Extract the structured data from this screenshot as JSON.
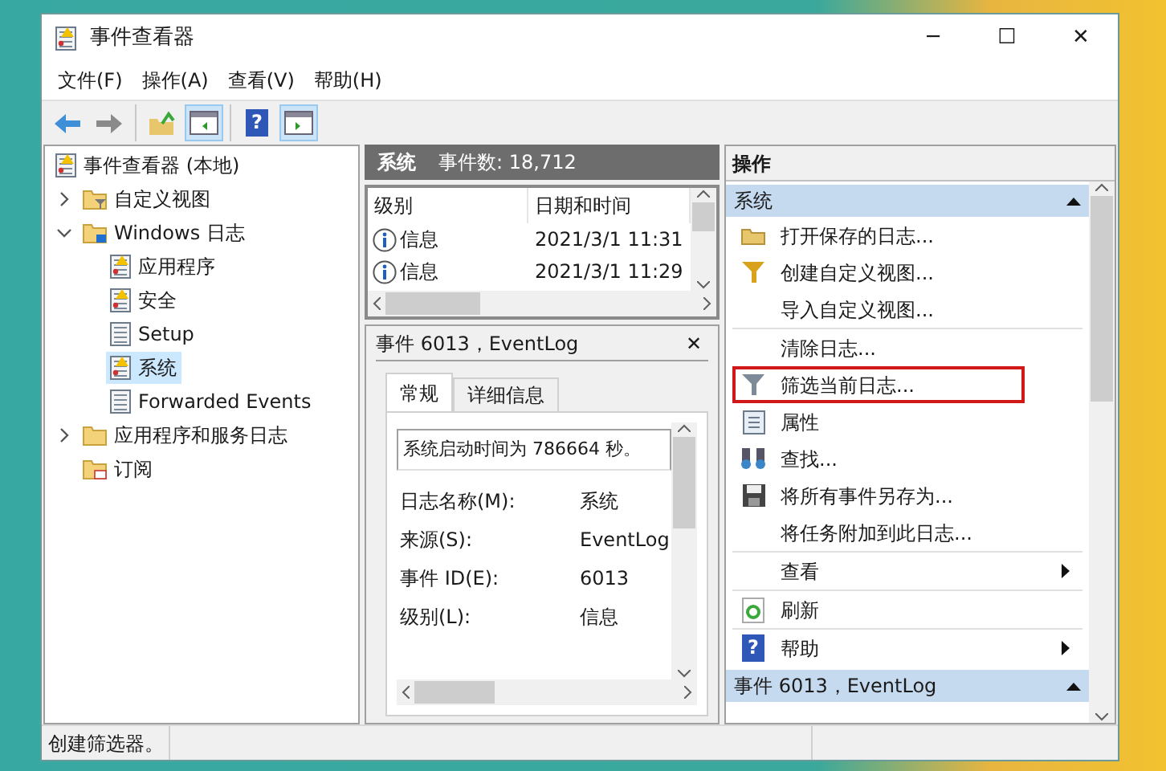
{
  "window": {
    "title": "事件查看器",
    "controls": [
      "─",
      "☐",
      "✕"
    ]
  },
  "menu": [
    {
      "label": "文件(F)"
    },
    {
      "label": "操作(A)"
    },
    {
      "label": "查看(V)"
    },
    {
      "label": "帮助(H)"
    }
  ],
  "toolbar": [
    [
      {
        "kind": "back",
        "pressed": false
      },
      {
        "kind": "forward",
        "pressed": false
      }
    ],
    [
      {
        "kind": "up",
        "pressed": false
      },
      {
        "kind": "tree-toggle",
        "pressed": true
      }
    ],
    [
      {
        "kind": "help",
        "glyph": "?",
        "pressed": false
      },
      {
        "kind": "actions-toggle",
        "pressed": true
      }
    ]
  ],
  "tree": {
    "root": "事件查看器 (本地)",
    "items": [
      {
        "label": "自定义视图",
        "kind": "filter-folder",
        "expanded": false,
        "selected": false
      },
      {
        "label": "Windows 日志",
        "kind": "windows-folder",
        "expanded": true,
        "selected": false,
        "children": [
          {
            "label": "应用程序",
            "kind": "log-warn",
            "selected": false
          },
          {
            "label": "安全",
            "kind": "log-warn",
            "selected": false
          },
          {
            "label": "Setup",
            "kind": "log",
            "selected": false
          },
          {
            "label": "系统",
            "kind": "log-warn",
            "selected": true
          },
          {
            "label": "Forwarded Events",
            "kind": "log",
            "selected": false
          }
        ]
      },
      {
        "label": "应用程序和服务日志",
        "kind": "folder",
        "expanded": false,
        "selected": false
      },
      {
        "label": "订阅",
        "kind": "sub-folder",
        "selected": false
      }
    ]
  },
  "log_header": {
    "name": "系统",
    "count": "事件数: 18,712"
  },
  "events_table": {
    "columns": [
      "级别",
      "日期和时间"
    ],
    "rows": [
      {
        "level": "信息",
        "datetime": "2021/3/1 11:31"
      },
      {
        "level": "信息",
        "datetime": "2021/3/1 11:29"
      }
    ]
  },
  "event_detail": {
    "title": "事件 6013，EventLog",
    "close": "✕",
    "tabs": [
      {
        "label": "常规",
        "selected": true
      },
      {
        "label": "详细信息",
        "selected": false
      }
    ],
    "message": "系统启动时间为 786664 秒。",
    "fields": [
      {
        "label": "日志名称(M):",
        "value": "系统"
      },
      {
        "label": "来源(S):",
        "value": "EventLog"
      },
      {
        "label": "事件 ID(E):",
        "value": "6013"
      },
      {
        "label": "级别(L):",
        "value": "信息"
      }
    ]
  },
  "actions": {
    "title": "操作",
    "sections": [
      {
        "title": "系统",
        "expanded": true,
        "groups": [
          [
            {
              "label": "打开保存的日志...",
              "kind": "folder",
              "highlighted": false,
              "submenu": false
            },
            {
              "label": "创建自定义视图...",
              "kind": "filter",
              "highlighted": false,
              "submenu": false
            },
            {
              "label": "导入自定义视图...",
              "kind": "plain",
              "highlighted": false,
              "submenu": false
            }
          ],
          [
            {
              "label": "清除日志...",
              "kind": "plain",
              "highlighted": false,
              "submenu": false
            },
            {
              "label": "筛选当前日志...",
              "kind": "filter-gray",
              "highlighted": true,
              "submenu": false
            },
            {
              "label": "属性",
              "kind": "properties",
              "highlighted": false,
              "submenu": false
            },
            {
              "label": "查找...",
              "kind": "binoculars",
              "highlighted": false,
              "submenu": false
            },
            {
              "label": "将所有事件另存为...",
              "kind": "disk",
              "highlighted": false,
              "submenu": false
            },
            {
              "label": "将任务附加到此日志...",
              "kind": "plain",
              "highlighted": false,
              "submenu": false
            }
          ],
          [
            {
              "label": "查看",
              "kind": "plain",
              "highlighted": false,
              "submenu": true
            }
          ],
          [
            {
              "label": "刷新",
              "kind": "refresh",
              "highlighted": false,
              "submenu": false
            }
          ],
          [
            {
              "label": "帮助",
              "kind": "help",
              "glyph": "?",
              "highlighted": false,
              "submenu": true
            }
          ]
        ]
      },
      {
        "title": "事件 6013，EventLog",
        "expanded": true
      }
    ]
  },
  "status_bar": {
    "text": "创建筛选器。"
  }
}
